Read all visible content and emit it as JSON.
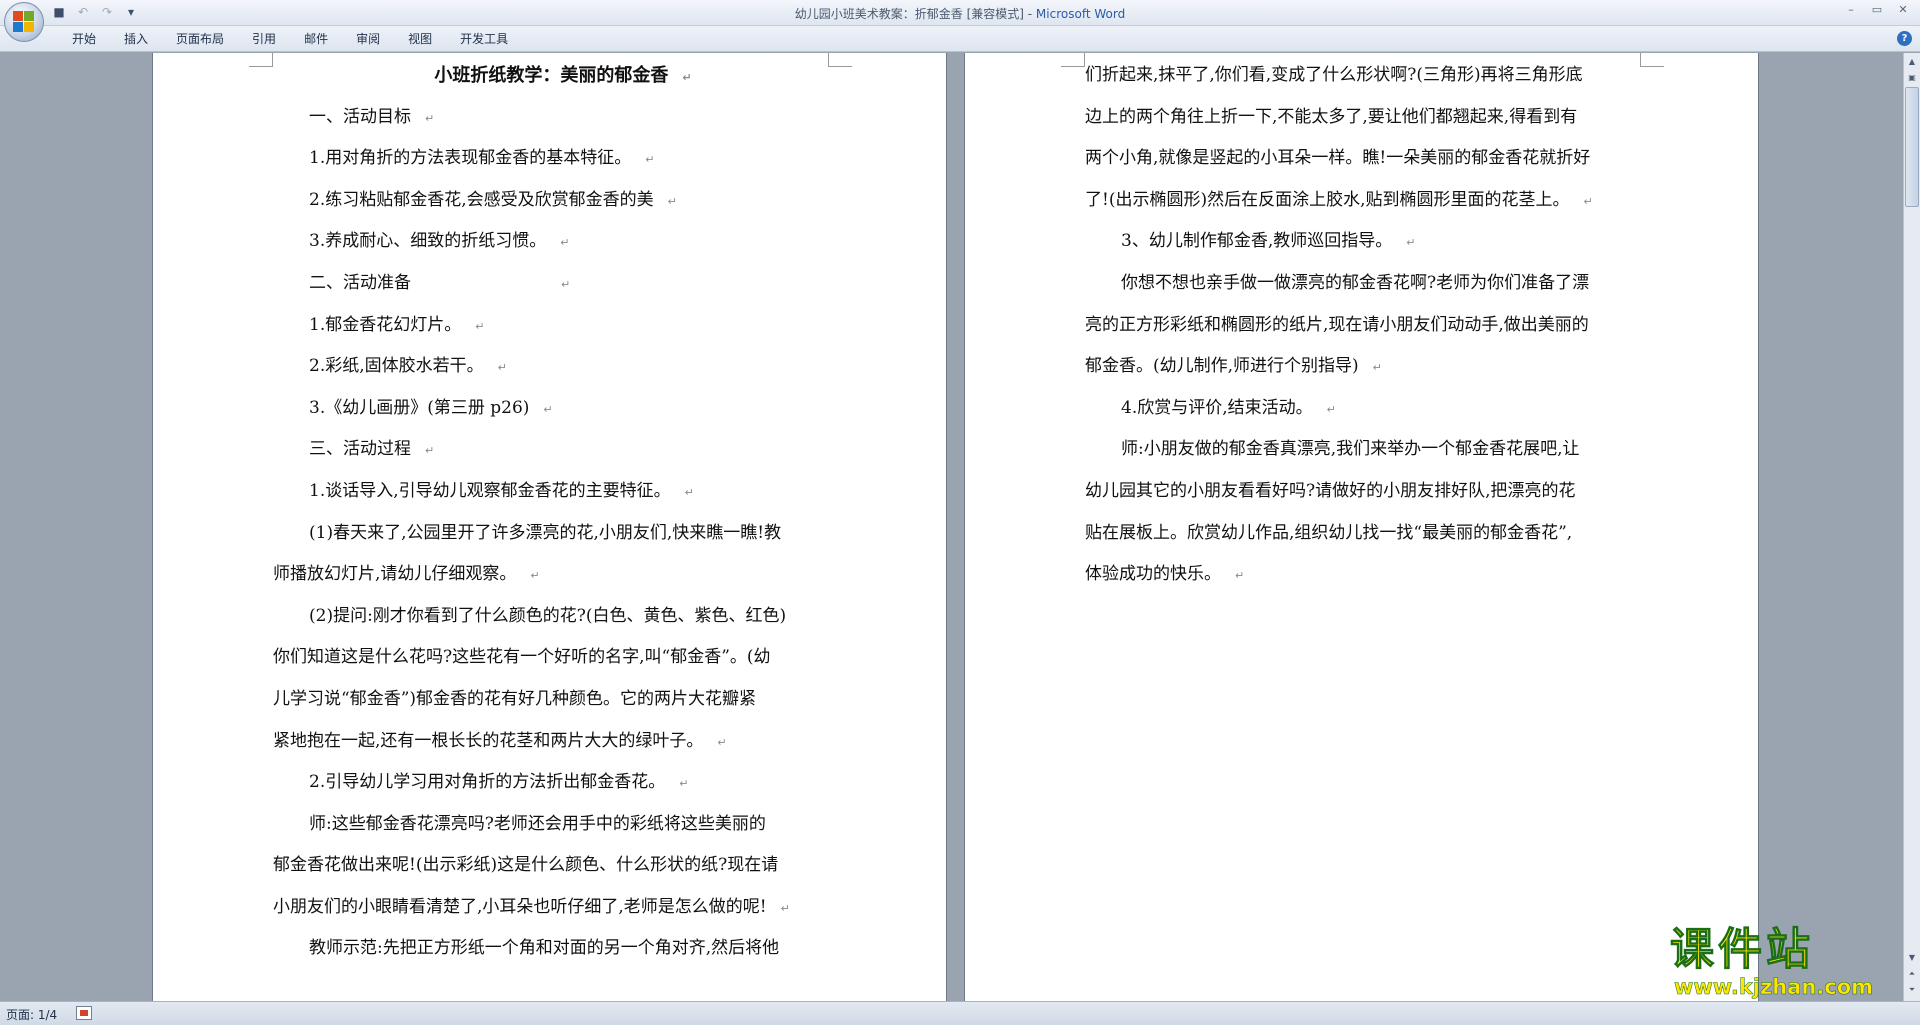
{
  "window": {
    "title": "幼儿园小班美术教案：折郁金香 [兼容模式] - ",
    "app_name": "Microsoft Word",
    "controls": [
      "–",
      "▭",
      "✕"
    ]
  },
  "quick_access": {
    "save_icon": "save-icon",
    "undo_icon": "undo-icon",
    "redo_icon": "redo-icon",
    "customize_icon": "customize-icon"
  },
  "ribbon": {
    "tabs": [
      "开始",
      "插入",
      "页面布局",
      "引用",
      "邮件",
      "审阅",
      "视图",
      "开发工具"
    ],
    "help": "?"
  },
  "page1": {
    "lines": [
      {
        "text": "小班折纸教学：美丽的郁金香",
        "mark": "↵",
        "style": "heading"
      },
      {
        "text": "一、活动目标",
        "mark": "↵",
        "indent": 36
      },
      {
        "text": "1.用对角折的方法表现郁金香的基本特征。",
        "mark": "↵",
        "indent": 36
      },
      {
        "text": "2.练习粘贴郁金香花,会感受及欣赏郁金香的美",
        "mark": "↵",
        "indent": 36
      },
      {
        "text": "3.养成耐心、细致的折纸习惯。",
        "mark": "↵",
        "indent": 36
      },
      {
        "text": "二、活动准备",
        "mark": "↵",
        "indent": 36,
        "gap": 150
      },
      {
        "text": "1.郁金香花幻灯片。",
        "mark": "↵",
        "indent": 36
      },
      {
        "text": "2.彩纸,固体胶水若干。",
        "mark": "↵",
        "indent": 36
      },
      {
        "text": "3.《幼儿画册》(第三册 p26)",
        "mark": "↵",
        "indent": 36
      },
      {
        "text": "三、活动过程",
        "mark": "↵",
        "indent": 36
      },
      {
        "text": "1.谈话导入,引导幼儿观察郁金香花的主要特征。",
        "mark": "↵",
        "indent": 36
      },
      {
        "text": "(1)春天来了,公园里开了许多漂亮的花,小朋友们,快来瞧一瞧!教",
        "mark": "",
        "indent": 36
      },
      {
        "text": "师播放幻灯片,请幼儿仔细观察。",
        "mark": "↵",
        "indent": 0
      },
      {
        "text": "(2)提问:刚才你看到了什么颜色的花?(白色、黄色、紫色、红色)",
        "mark": "",
        "indent": 36
      },
      {
        "text": "你们知道这是什么花吗?这些花有一个好听的名字,叫“郁金香”。(幼",
        "mark": "",
        "indent": 0
      },
      {
        "text": "儿学习说“郁金香”)郁金香的花有好几种颜色。它的两片大花瓣紧",
        "mark": "",
        "indent": 0
      },
      {
        "text": "紧地抱在一起,还有一根长长的花茎和两片大大的绿叶子。",
        "mark": "↵",
        "indent": 0
      },
      {
        "text": "2.引导幼儿学习用对角折的方法折出郁金香花。",
        "mark": "↵",
        "indent": 36
      },
      {
        "text": "师:这些郁金香花漂亮吗?老师还会用手中的彩纸将这些美丽的",
        "mark": "",
        "indent": 36
      },
      {
        "text": "郁金香花做出来呢!(出示彩纸)这是什么颜色、什么形状的纸?现在请",
        "mark": "",
        "indent": 0
      },
      {
        "text": "小朋友们的小眼睛看清楚了,小耳朵也听仔细了,老师是怎么做的呢!",
        "mark": "↵",
        "indent": 0
      },
      {
        "text": "教师示范:先把正方形纸一个角和对面的另一个角对齐,然后将他",
        "mark": "",
        "indent": 36
      }
    ]
  },
  "page2": {
    "lines": [
      {
        "text": "们折起来,抹平了,你们看,变成了什么形状啊?(三角形)再将三角形底",
        "mark": "",
        "indent": 0
      },
      {
        "text": "边上的两个角往上折一下,不能太多了,要让他们都翘起来,得看到有",
        "mark": "",
        "indent": 0
      },
      {
        "text": "两个小角,就像是竖起的小耳朵一样。瞧!一朵美丽的郁金香花就折好",
        "mark": "",
        "indent": 0
      },
      {
        "text": "了!(出示椭圆形)然后在反面涂上胶水,贴到椭圆形里面的花茎上。",
        "mark": "↵",
        "indent": 0
      },
      {
        "text": "3、幼儿制作郁金香,教师巡回指导。",
        "mark": "↵",
        "indent": 36
      },
      {
        "text": "你想不想也亲手做一做漂亮的郁金香花啊?老师为你们准备了漂",
        "mark": "",
        "indent": 36
      },
      {
        "text": "亮的正方形彩纸和椭圆形的纸片,现在请小朋友们动动手,做出美丽的",
        "mark": "",
        "indent": 0
      },
      {
        "text": "郁金香。(幼儿制作,师进行个别指导)",
        "mark": "↵",
        "indent": 0
      },
      {
        "text": "4.欣赏与评价,结束活动。",
        "mark": "↵",
        "indent": 36
      },
      {
        "text": "师:小朋友做的郁金香真漂亮,我们来举办一个郁金香花展吧,让",
        "mark": "",
        "indent": 36
      },
      {
        "text": "幼儿园其它的小朋友看看好吗?请做好的小朋友排好队,把漂亮的花",
        "mark": "",
        "indent": 0
      },
      {
        "text": "贴在展板上。欣赏幼儿作品,组织幼儿找一找“最美丽的郁金香花”,",
        "mark": "",
        "indent": 0
      },
      {
        "text": "体验成功的快乐。",
        "mark": "↵",
        "indent": 0
      }
    ]
  },
  "status": {
    "page": "页面: 1/4"
  },
  "watermark": {
    "cn": "课件站",
    "url": "www.kjzhan.com"
  }
}
